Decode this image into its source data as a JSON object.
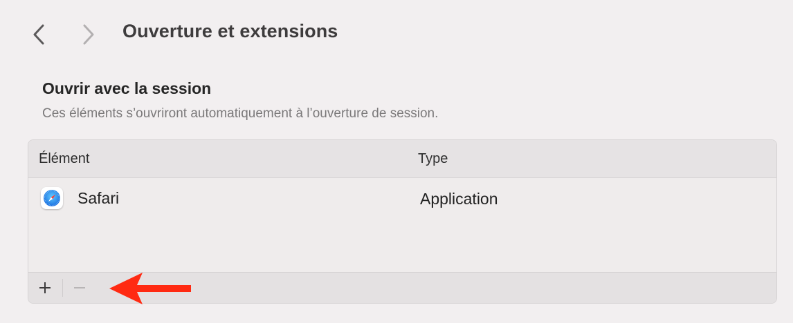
{
  "header": {
    "title": "Ouverture et extensions",
    "back_icon": "chevron-left-icon",
    "forward_icon": "chevron-right-icon"
  },
  "section": {
    "title": "Ouvrir avec la session",
    "description": "Ces éléments s’ouvriront automatiquement à l’ouverture de session."
  },
  "table": {
    "columns": [
      "Élément",
      "Type"
    ],
    "rows": [
      {
        "name": "Safari",
        "type": "Application",
        "icon": "safari-icon"
      }
    ],
    "footer": {
      "add_icon": "plus-icon",
      "remove_icon": "minus-icon"
    }
  },
  "colors": {
    "background": "#f2eff0",
    "annotation_arrow": "#ff2a12"
  }
}
